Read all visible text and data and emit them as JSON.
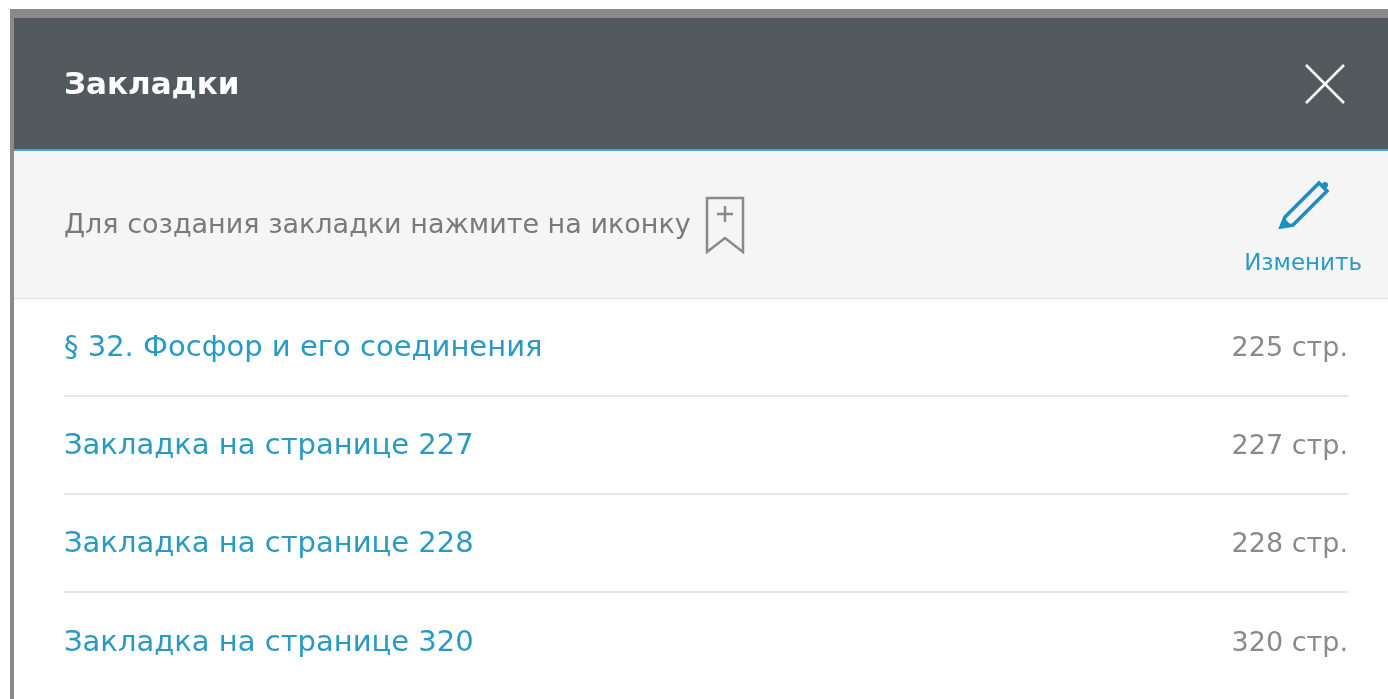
{
  "dialog": {
    "title": "Закладки"
  },
  "toolbar": {
    "hint": "Для создания закладки нажмите на иконку",
    "edit_label": "Изменить"
  },
  "bookmarks": [
    {
      "title": "§ 32. Фосфор и его соединения",
      "page": "225 стр."
    },
    {
      "title": "Закладка на странице 227",
      "page": "227 стр."
    },
    {
      "title": "Закладка на странице 228",
      "page": "228 стр."
    },
    {
      "title": "Закладка на странице 320",
      "page": "320 стр."
    }
  ]
}
